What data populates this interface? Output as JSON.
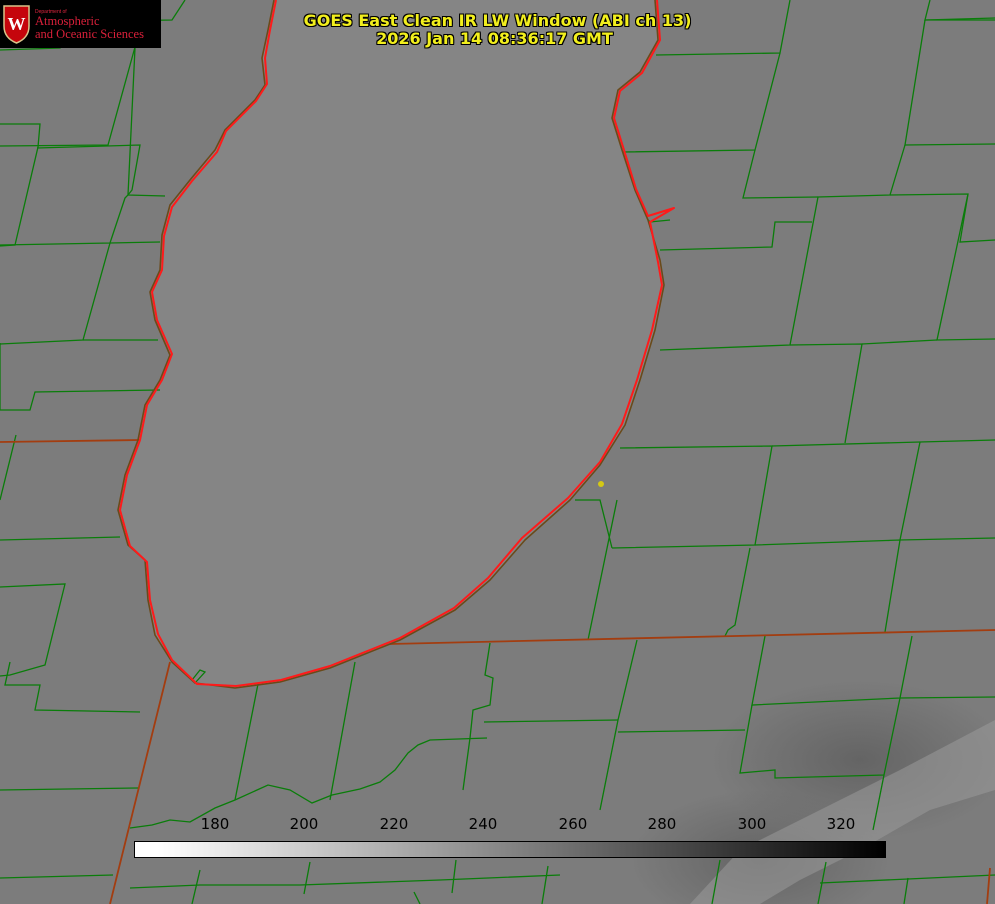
{
  "header": {
    "title_line1": "GOES East Clean IR LW Window (ABI ch 13)",
    "title_line2": "2026 Jan 14 08:36:17 GMT"
  },
  "logo": {
    "dept": "Department of",
    "line1": "Atmospheric",
    "line2": "and Oceanic Sciences",
    "crest_letter": "W"
  },
  "colors": {
    "background_gray": "#7d7d7d",
    "county_line": "#0a7d0a",
    "state_line": "#a33d10",
    "shoreline": "#ff1a1a",
    "title_text": "#f2ef1d",
    "marker": "#d4c814"
  },
  "colorbar": {
    "ticks": [
      "180",
      "200",
      "220",
      "240",
      "260",
      "280",
      "300",
      "320"
    ],
    "gradient": "white to black"
  },
  "map": {
    "marker_icon": "location-dot-icon"
  }
}
